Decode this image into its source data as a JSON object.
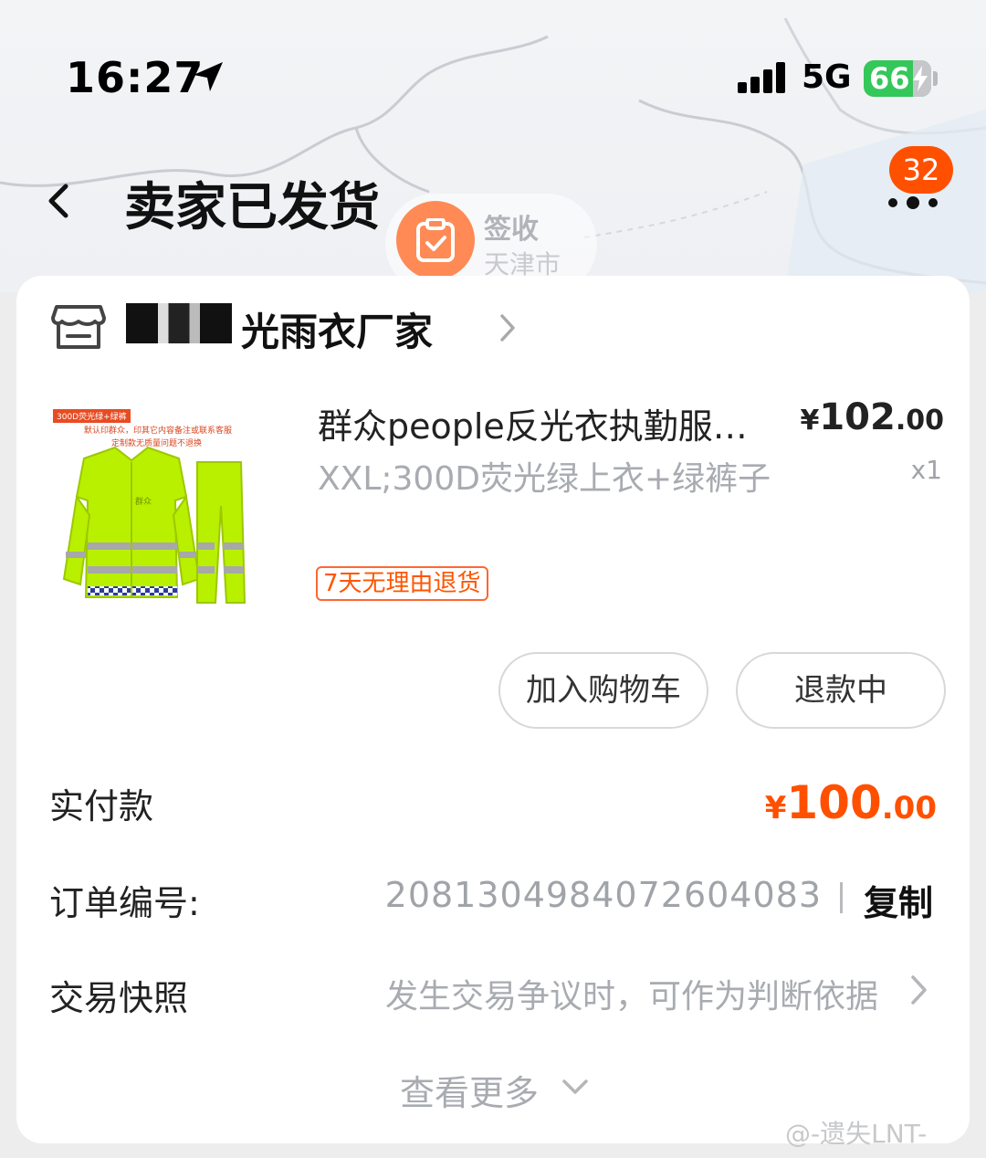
{
  "status_bar": {
    "time": "16:27",
    "network": "5G",
    "battery": "66",
    "icons": [
      "location-arrow-icon",
      "signal-icon",
      "battery-charging-icon"
    ]
  },
  "header": {
    "title": "卖家已发货",
    "badge_count": "32",
    "icons": [
      "back-icon",
      "more-icon"
    ]
  },
  "map_chip": {
    "title": "签收",
    "city": "天津市",
    "icon": "clipboard-check-icon"
  },
  "shop": {
    "name": "光雨衣厂家",
    "icon": "store-icon"
  },
  "product": {
    "image_tag": "300D荧光绿+绿裤",
    "image_note_1": "默认印群众，印其它内容备注或联系客服",
    "image_note_2": "定制款无质量问题不退换",
    "image_print": "群众",
    "title": "群众people反光衣执勤服…",
    "price_currency": "¥",
    "price_int": "102",
    "price_dec": ".00",
    "quantity": "x1",
    "sku": "XXL;300D荧光绿上衣+绿裤子",
    "return_policy": "7天无理由退货"
  },
  "actions": {
    "add_to_cart": "加入购物车",
    "refund_status": "退款中"
  },
  "order": {
    "paid_label": "实付款",
    "paid_currency": "¥",
    "paid_int": "100",
    "paid_dec": ".00",
    "order_no_label": "订单编号:",
    "order_no": "2081304984072604083",
    "copy_label": "复制",
    "snapshot_label": "交易快照",
    "snapshot_desc": "发生交易争议时，可作为判断依据",
    "view_more": "查看更多"
  },
  "watermark": "@-遗失LNT-",
  "colors": {
    "accent": "#ff5000",
    "battery": "#34c759",
    "badge": "#ff5000"
  }
}
